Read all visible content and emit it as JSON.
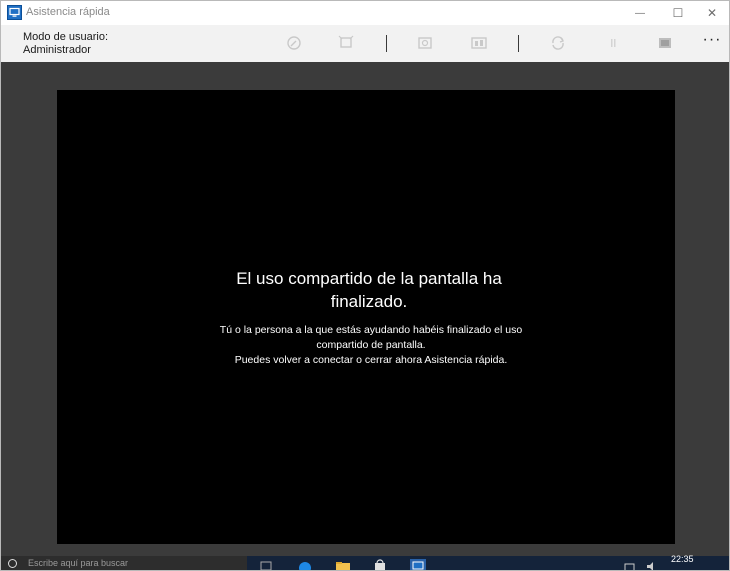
{
  "window": {
    "title": "Asistencia rápida",
    "minimize_glyph": "—",
    "maximize_glyph": "☐",
    "close_glyph": "✕"
  },
  "toolbar": {
    "user_mode_label": "Modo de usuario:",
    "user_mode_value": "Administrador",
    "icons": [
      "annotate-icon",
      "fit-screen-icon",
      "restart-icon",
      "task-manager-icon",
      "reconnect-icon",
      "pause-icon",
      "end-icon"
    ],
    "more_label": "···"
  },
  "remote": {
    "title": "El uso compartido de la pantalla ha finalizado.",
    "body_line1": "Tú o la persona a la que estás ayudando habéis finalizado el uso compartido de pantalla.",
    "body_line2": "Puedes volver a conectar o cerrar ahora Asistencia rápida."
  },
  "remote_taskbar": {
    "search_hint": "Escribe aquí para buscar",
    "clock": "22:35"
  },
  "colors": {
    "toolbar_bg": "#f2f2f2",
    "viewer_bg": "#3b3b3b",
    "remote_bg": "#000000",
    "taskbar_bg": "#14233a"
  }
}
